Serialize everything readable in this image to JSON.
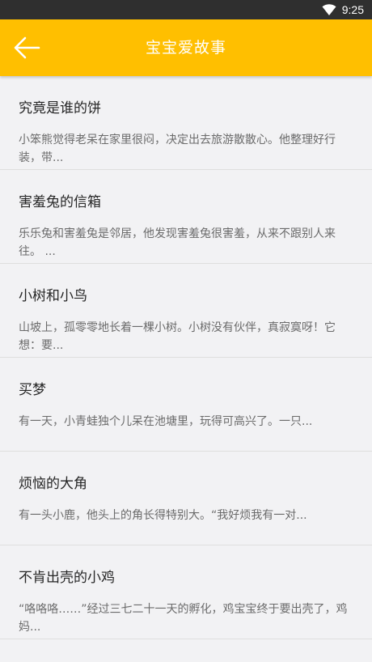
{
  "status_bar": {
    "time": "9:25",
    "icons": [
      "wifi-icon"
    ]
  },
  "app_bar": {
    "title": "宝宝爱故事",
    "back_icon": "arrow-left-icon",
    "color": "#ffbf00"
  },
  "stories": [
    {
      "title": "究竟是谁的饼",
      "summary": "小笨熊觉得老呆在家里很闷，决定出去旅游散散心。他整理好行装，带..."
    },
    {
      "title": "害羞兔的信箱",
      "summary": "乐乐兔和害羞兔是邻居，他发现害羞兔很害羞，从来不跟别人来往。 ..."
    },
    {
      "title": "小树和小鸟",
      "summary": "山坡上，孤零零地长着一棵小树。小树没有伙伴，真寂寞呀！它想：要..."
    },
    {
      "title": "买梦",
      "summary": "有一天，小青蛙独个儿呆在池塘里，玩得可高兴了。一只..."
    },
    {
      "title": "烦恼的大角",
      "summary": "有一头小鹿，他头上的角长得特别大。“我好烦我有一对..."
    },
    {
      "title": "不肯出壳的小鸡",
      "summary": "“咯咯咯……”经过三七二十一天的孵化，鸡宝宝终于要出壳了，鸡妈..."
    }
  ]
}
